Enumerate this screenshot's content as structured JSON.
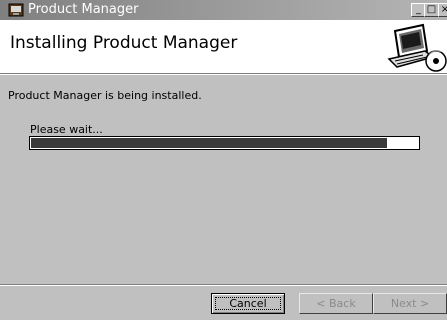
{
  "window": {
    "title": "Product Manager",
    "minimize_glyph": "_",
    "maximize_glyph": "□",
    "close_glyph": "×"
  },
  "header": {
    "title": "Installing Product Manager"
  },
  "body": {
    "status_text": "Product Manager is being installed.",
    "wait_label": "Please wait...",
    "progress": 0.92
  },
  "buttons": {
    "cancel": "Cancel",
    "back": "< Back",
    "next": "Next >"
  },
  "icons": {
    "app": "installer-icon",
    "header_art": "computer-disc-icon"
  },
  "colors": {
    "window_bg": "#c0c0c0",
    "titlebar_start": "#808080",
    "progress_fill": "#3a3a3a"
  }
}
